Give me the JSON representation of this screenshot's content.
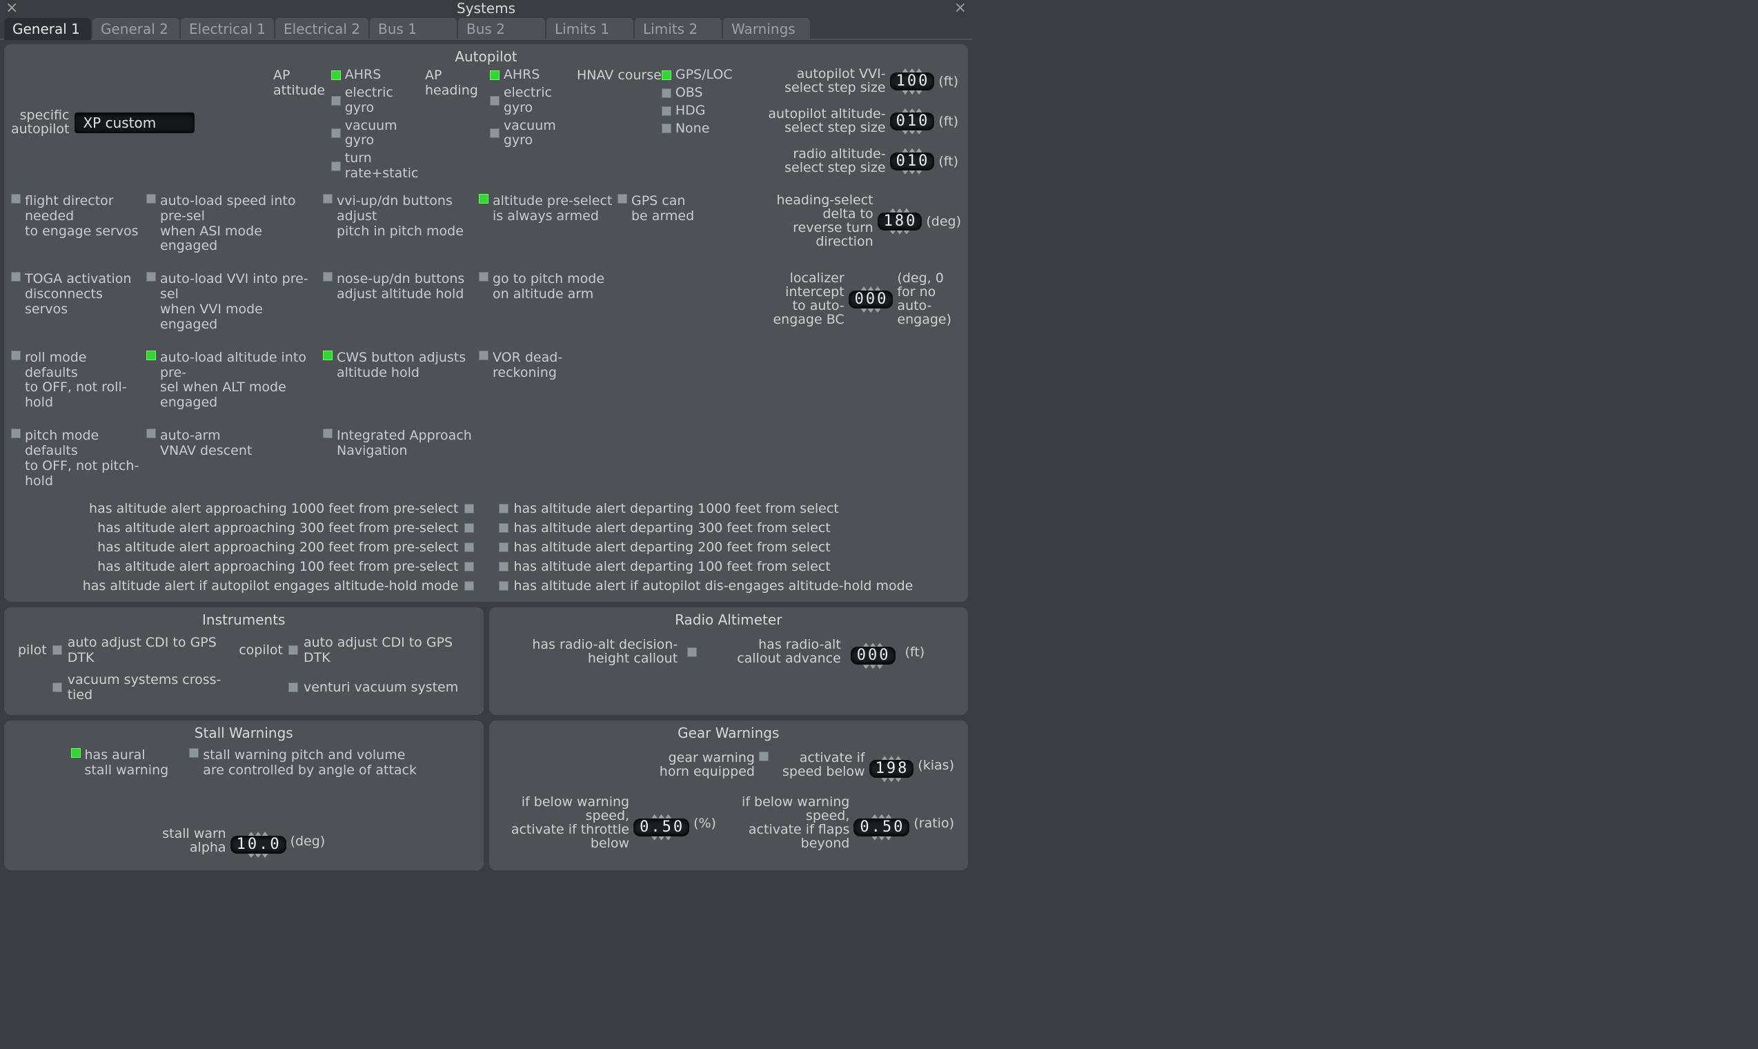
{
  "window": {
    "title": "Systems"
  },
  "tabs": [
    "General 1",
    "General 2",
    "Electrical 1",
    "Electrical 2",
    "Bus 1",
    "Bus 2",
    "Limits 1",
    "Limits 2",
    "Warnings"
  ],
  "active_tab": 0,
  "autopilot": {
    "title": "Autopilot",
    "ap_attitude": {
      "label": "AP attitude",
      "options": [
        "AHRS",
        "electric gyro",
        "vacuum gyro",
        "turn rate+static"
      ],
      "selected": 0
    },
    "ap_heading": {
      "label": "AP heading",
      "options": [
        "AHRS",
        "electric gyro",
        "vacuum gyro"
      ],
      "selected": 0
    },
    "hnav_course": {
      "label": "HNAV course",
      "options": [
        "GPS/LOC",
        "OBS",
        "HDG",
        "None"
      ],
      "selected": 0
    },
    "specific_label1": "specific",
    "specific_label2": "autopilot",
    "specific_value": "XP custom",
    "spin_vvi": {
      "label1": "autopilot VVI-",
      "label2": "select step size",
      "value": "100",
      "unit": "(ft)"
    },
    "spin_alt": {
      "label1": "autopilot altitude-",
      "label2": "select step size",
      "value": "010",
      "unit": "(ft)"
    },
    "spin_radalt": {
      "label1": "radio altitude-",
      "label2": "select step size",
      "value": "010",
      "unit": "(ft)"
    },
    "spin_hdg": {
      "label1": "heading-select delta to",
      "label2": "reverse turn direction",
      "value": "180",
      "unit": "(deg)"
    },
    "spin_loc": {
      "label1": "localizer intercept",
      "label2": "to auto-engage BC",
      "value": "000",
      "unit1": "(deg, 0 for no",
      "unit2": "auto-engage)"
    },
    "checks": [
      [
        {
          "l1": "flight director needed",
          "l2": "to engage servos",
          "on": false
        },
        {
          "l1": "auto-load speed into pre-sel",
          "l2": "when ASI mode engaged",
          "on": false
        },
        {
          "l1": "vvi-up/dn buttons adjust",
          "l2": "pitch in pitch mode",
          "on": false
        },
        {
          "l1": "altitude pre-select",
          "l2": "is always armed",
          "on": true
        },
        {
          "l1": "GPS can",
          "l2": "be armed",
          "on": false
        }
      ],
      [
        {
          "l1": "TOGA activation",
          "l2": "disconnects servos",
          "on": false
        },
        {
          "l1": "auto-load VVI into pre-sel",
          "l2": "when VVI mode engaged",
          "on": false
        },
        {
          "l1": "nose-up/dn buttons",
          "l2": "adjust altitude hold",
          "on": false
        },
        {
          "l1": "go to pitch mode",
          "l2": "on altitude arm",
          "on": false
        },
        null
      ],
      [
        {
          "l1": "roll mode defaults",
          "l2": "to OFF, not roll-hold",
          "on": false
        },
        {
          "l1": "auto-load altitude into pre-",
          "l2": "sel when ALT mode engaged",
          "on": true
        },
        {
          "l1": "CWS button adjusts",
          "l2": "altitude hold",
          "on": true
        },
        {
          "l1": "VOR dead-",
          "l2": "reckoning",
          "on": false
        },
        null
      ],
      [
        {
          "l1": "pitch mode defaults",
          "l2": "to OFF, not pitch-hold",
          "on": false
        },
        {
          "l1": "auto-arm",
          "l2": "VNAV descent",
          "on": false
        },
        {
          "l1": "Integrated Approach",
          "l2": "Navigation",
          "on": false
        },
        null,
        null
      ]
    ],
    "alerts_left": [
      "has altitude alert approaching 1000 feet from pre-select",
      "has altitude alert approaching 300 feet from pre-select",
      "has altitude alert approaching 200 feet from pre-select",
      "has altitude alert approaching 100 feet from pre-select",
      "has altitude alert if autopilot engages altitude-hold mode"
    ],
    "alerts_right": [
      "has altitude alert departing 1000 feet from select",
      "has altitude alert departing 300 feet from select",
      "has altitude alert departing 200 feet from select",
      "has altitude alert departing 100 feet from select",
      "has altitude alert if autopilot dis-engages altitude-hold mode"
    ]
  },
  "instruments": {
    "title": "Instruments",
    "pilot_label": "pilot",
    "copilot_label": "copilot",
    "auto_adj_cdi": "auto adjust CDI to GPS DTK",
    "vac_cross": "vacuum systems cross-tied",
    "venturi": "venturi vacuum system"
  },
  "radalt": {
    "title": "Radio Altimeter",
    "dh_label1": "has radio-alt decision-",
    "dh_label2": "height callout",
    "adv_label1": "has radio-alt",
    "adv_label2": "callout advance",
    "adv_value": "000",
    "adv_unit": "(ft)"
  },
  "stall": {
    "title": "Stall Warnings",
    "aural_l1": "has aural",
    "aural_l2": "stall warning",
    "pv_l1": "stall warning pitch and volume",
    "pv_l2": "are controlled by angle of attack",
    "alpha_l1": "stall warn",
    "alpha_l2": "alpha",
    "alpha_value": "10.0",
    "alpha_unit": "(deg)"
  },
  "gear": {
    "title": "Gear Warnings",
    "horn_l1": "gear warning",
    "horn_l2": "horn equipped",
    "speed_l1": "activate if",
    "speed_l2": "speed below",
    "speed_value": "198",
    "speed_unit": "(kias)",
    "throttle_l1": "if below warning speed,",
    "throttle_l2": "activate if throttle below",
    "throttle_value": "0.50",
    "throttle_unit": "(%)",
    "flaps_l1": "if below warning speed,",
    "flaps_l2": "activate if flaps beyond",
    "flaps_value": "0.50",
    "flaps_unit": "(ratio)"
  }
}
